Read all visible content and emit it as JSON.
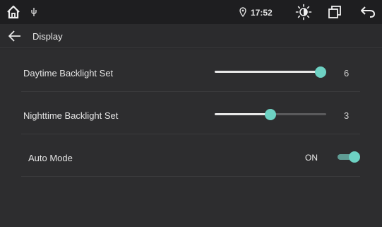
{
  "status_bar": {
    "time": "17:52",
    "icons": [
      "home-icon",
      "usb-icon",
      "location-pin-icon",
      "brightness-icon",
      "recent-apps-icon",
      "back-arrow-icon"
    ]
  },
  "app_bar": {
    "back_icon": "arrow-left-icon",
    "title": "Display"
  },
  "settings": [
    {
      "label": "Daytime Backlight Set",
      "value": "6",
      "level": 1.0
    },
    {
      "label": "Nighttime Backlight Set",
      "value": "3",
      "level": 0.5
    },
    {
      "label": "Auto Mode",
      "state": "ON",
      "enabled": true
    }
  ],
  "colors": {
    "accent": "#6dd1c3",
    "background": "#2d2d2f",
    "status_bar": "#1e1e20",
    "text": "#e4e4e4"
  }
}
